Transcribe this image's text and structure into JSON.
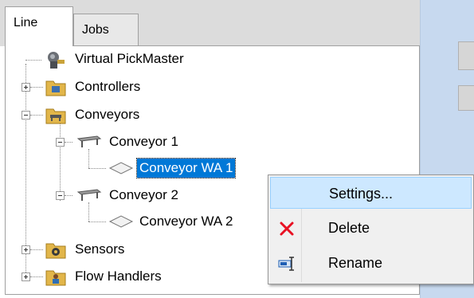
{
  "tabs": [
    {
      "label": "Line",
      "active": true
    },
    {
      "label": "Jobs",
      "active": false
    }
  ],
  "tree": {
    "root": "Virtual PickMaster",
    "controllers": "Controllers",
    "conveyors": "Conveyors",
    "conveyor1": "Conveyor 1",
    "conveyor_wa1": "Conveyor WA 1",
    "conveyor2": "Conveyor 2",
    "conveyor_wa2": "Conveyor WA 2",
    "sensors": "Sensors",
    "flow_handlers": "Flow Handlers"
  },
  "context_menu": {
    "settings": "Settings...",
    "delete": "Delete",
    "rename": "Rename"
  },
  "colors": {
    "selection": "#0078d7",
    "menu_hover": "#cde8ff",
    "delete_icon": "#e81123",
    "rename_icon": "#1e5fb4"
  },
  "icons": [
    "robot-icon",
    "folder-icon",
    "conveyor-icon",
    "workarea-icon",
    "x-icon",
    "rename-icon",
    "sensor-icon",
    "flow-handler-icon"
  ]
}
